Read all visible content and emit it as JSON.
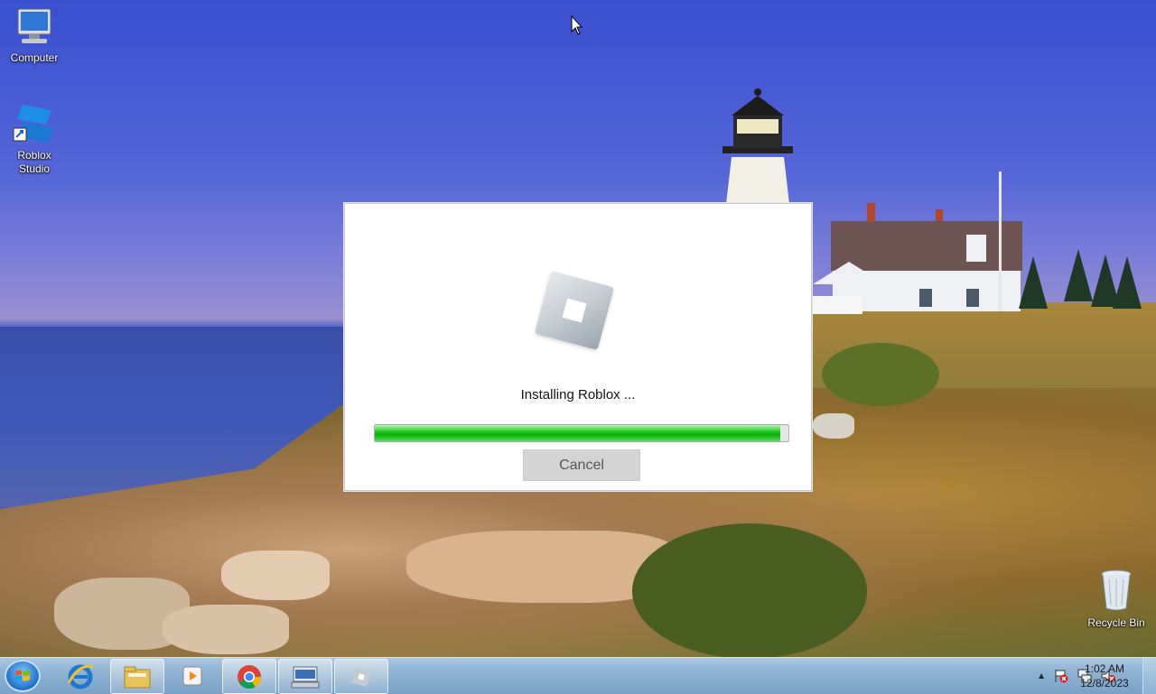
{
  "desktop": {
    "icons": [
      {
        "label": "Computer",
        "icon": "computer-icon"
      },
      {
        "label": "Roblox Studio",
        "icon": "roblox-studio-icon"
      },
      {
        "label": "Recycle Bin",
        "icon": "recycle-bin-icon"
      }
    ]
  },
  "installer": {
    "status_text": "Installing Roblox ...",
    "progress_fraction": 0.98,
    "cancel_label": "Cancel",
    "logo": "roblox-logo-icon",
    "accent_color": "#13c013"
  },
  "taskbar": {
    "start_icon": "windows-start-icon",
    "buttons": [
      {
        "icon": "internet-explorer-icon"
      },
      {
        "icon": "file-explorer-icon"
      },
      {
        "icon": "media-player-icon"
      },
      {
        "icon": "chrome-icon"
      },
      {
        "icon": "on-screen-keyboard-icon"
      },
      {
        "icon": "roblox-installer-icon"
      }
    ],
    "tray_icons": [
      "show-hidden-icons-icon",
      "action-center-flag-icon",
      "network-icon",
      "volume-muted-icon"
    ],
    "clock": {
      "time": "1:02 AM",
      "date": "12/8/2023"
    }
  }
}
